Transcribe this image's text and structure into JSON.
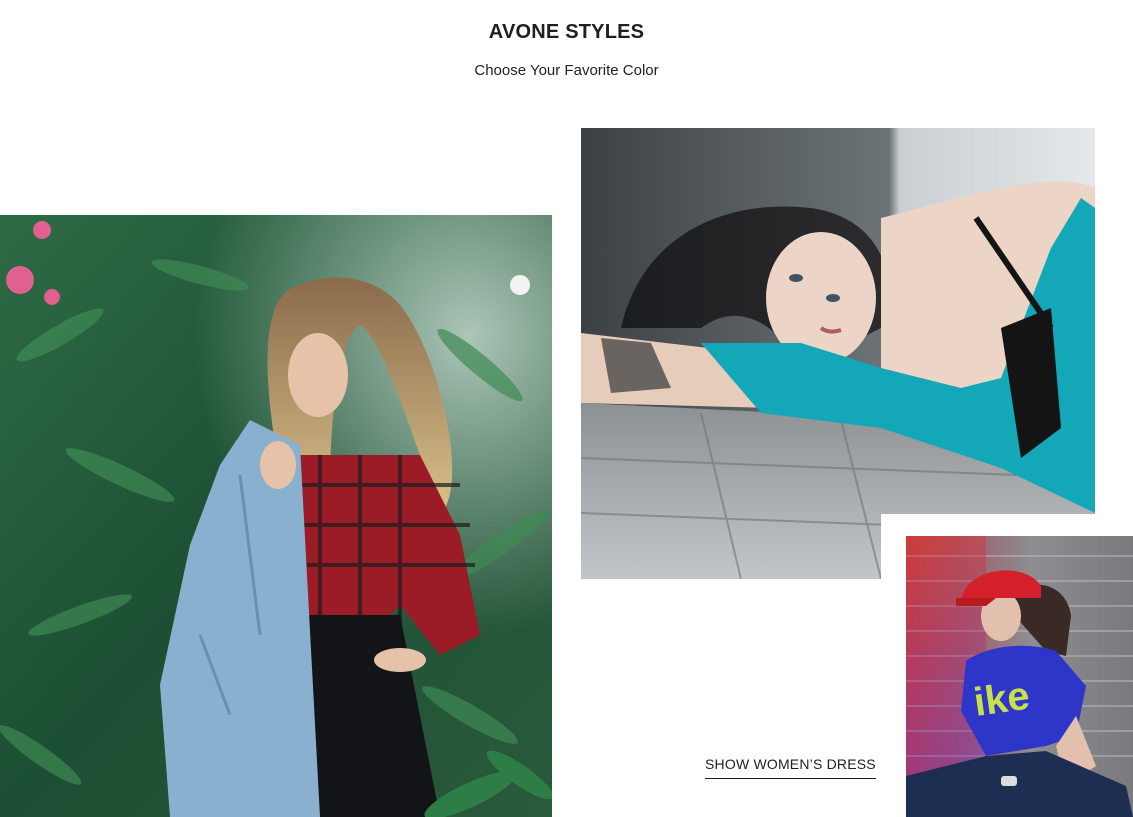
{
  "section": {
    "title": "AVONE STYLES",
    "subtitle": "Choose Your Favorite Color"
  },
  "cta": {
    "label": "SHOW WOMEN’S DRESS"
  },
  "colors": {
    "foliage": "#1f5a3a",
    "denim": "#8ab0cf",
    "plaid": "#9b1c26",
    "teal_top": "#13a7b8",
    "cap_red": "#d4202a",
    "shirt_blue": "#2d36c8",
    "brick": "#8c8c8c"
  }
}
